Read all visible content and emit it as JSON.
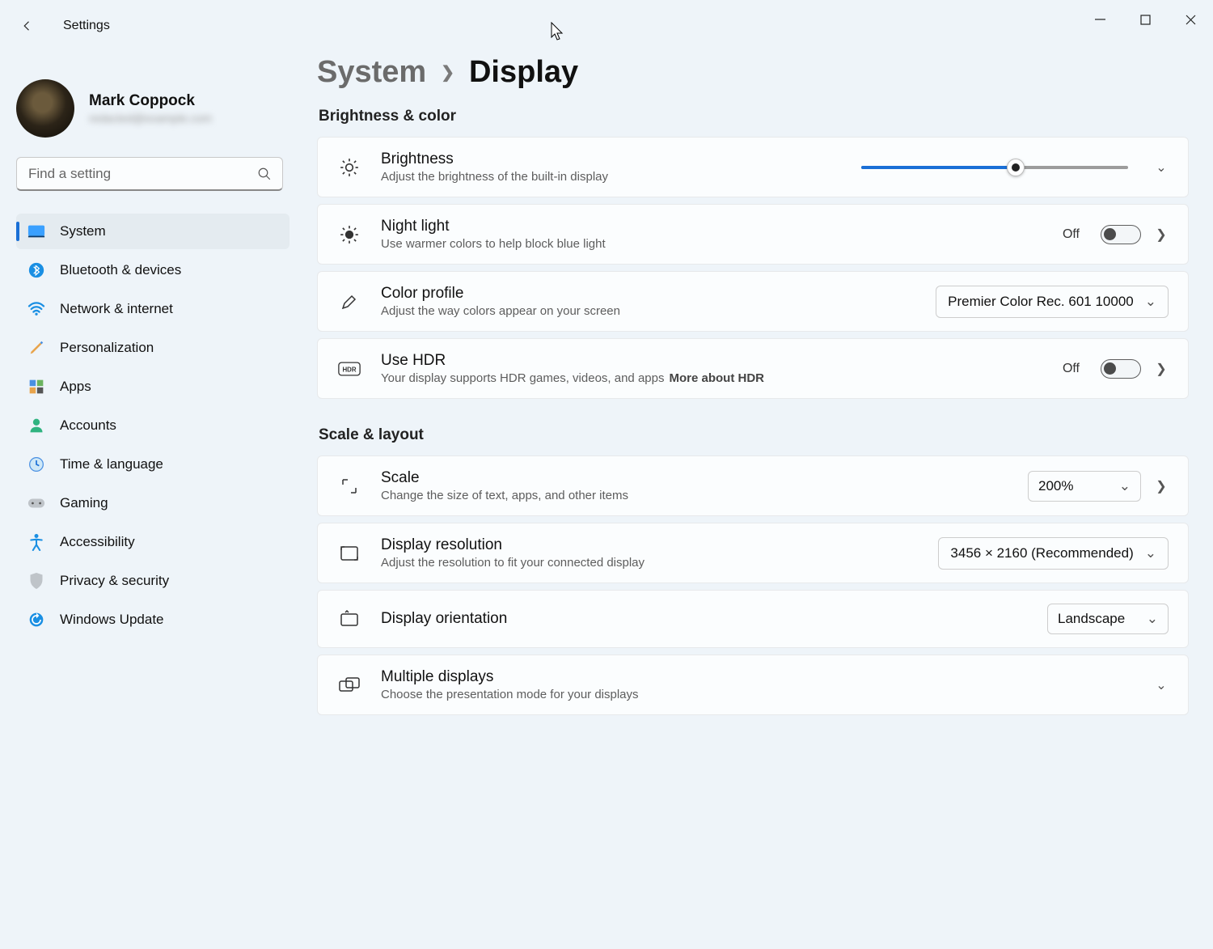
{
  "app": {
    "title": "Settings"
  },
  "user": {
    "name": "Mark Coppock",
    "email": "redacted@example.com"
  },
  "search": {
    "placeholder": "Find a setting"
  },
  "nav": {
    "system": "System",
    "bluetooth": "Bluetooth & devices",
    "network": "Network & internet",
    "personalization": "Personalization",
    "apps": "Apps",
    "accounts": "Accounts",
    "time": "Time & language",
    "gaming": "Gaming",
    "accessibility": "Accessibility",
    "privacy": "Privacy & security",
    "update": "Windows Update"
  },
  "breadcrumb": {
    "parent": "System",
    "current": "Display"
  },
  "sections": {
    "brightness_color": "Brightness & color",
    "scale_layout": "Scale & layout"
  },
  "rows": {
    "brightness": {
      "title": "Brightness",
      "sub": "Adjust the brightness of the built-in display",
      "value_pct": 58
    },
    "nightlight": {
      "title": "Night light",
      "sub": "Use warmer colors to help block blue light",
      "state": "Off"
    },
    "colorprofile": {
      "title": "Color profile",
      "sub": "Adjust the way colors appear on your screen",
      "selected": "Premier Color Rec. 601 10000"
    },
    "hdr": {
      "title": "Use HDR",
      "sub": "Your display supports HDR games, videos, and apps",
      "link": "More about HDR",
      "state": "Off"
    },
    "scale": {
      "title": "Scale",
      "sub": "Change the size of text, apps, and other items",
      "selected": "200%"
    },
    "resolution": {
      "title": "Display resolution",
      "sub": "Adjust the resolution to fit your connected display",
      "selected": "3456 × 2160 (Recommended)"
    },
    "orientation": {
      "title": "Display orientation",
      "selected": "Landscape"
    },
    "multi": {
      "title": "Multiple displays",
      "sub": "Choose the presentation mode for your displays"
    }
  }
}
